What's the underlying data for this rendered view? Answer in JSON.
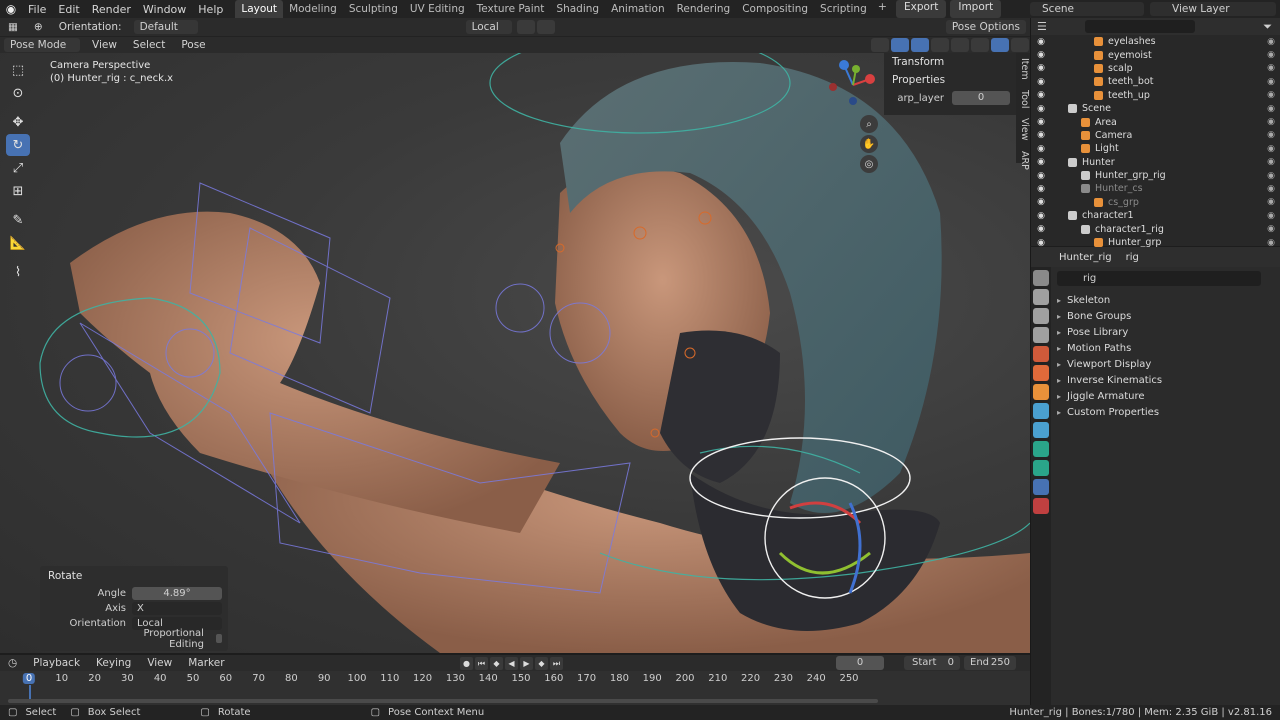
{
  "topbar": {
    "menus": [
      "File",
      "Edit",
      "Render",
      "Window",
      "Help"
    ],
    "workspaces": [
      "Layout",
      "Modeling",
      "Sculpting",
      "UV Editing",
      "Texture Paint",
      "Shading",
      "Animation",
      "Rendering",
      "Compositing",
      "Scripting"
    ],
    "active_workspace": "Layout",
    "export_label": "Export",
    "import_label": "Import",
    "scene": "Scene",
    "view_layer": "View Layer"
  },
  "viewport_header": {
    "orientation_label": "Orientation:",
    "orientation_value": "Default",
    "transform_space": "Local",
    "pose_options": "Pose Options",
    "mode": "Pose Mode",
    "menus": [
      "View",
      "Select",
      "Pose"
    ]
  },
  "viewport": {
    "camera_label": "Camera Perspective",
    "object_label": "(0) Hunter_rig : c_neck.x"
  },
  "npanel": {
    "transform": "Transform",
    "properties": "Properties",
    "field_label": "arp_layer",
    "field_value": "0",
    "tabs": [
      "Item",
      "Tool",
      "View",
      "ARP"
    ]
  },
  "operator": {
    "title": "Rotate",
    "angle_label": "Angle",
    "angle_value": "4.89°",
    "axis_label": "Axis",
    "axis_value": "X",
    "orientation_label": "Orientation",
    "orientation_value": "Local",
    "proportional_label": "Proportional Editing"
  },
  "timeline": {
    "menus": [
      "Playback",
      "Keying",
      "View",
      "Marker"
    ],
    "current_frame": "0",
    "start_label": "Start",
    "start_value": "0",
    "end_label": "End",
    "end_value": "250",
    "ticks": [
      "0",
      "10",
      "20",
      "30",
      "40",
      "50",
      "60",
      "70",
      "80",
      "90",
      "100",
      "110",
      "120",
      "130",
      "140",
      "150",
      "160",
      "170",
      "180",
      "190",
      "200",
      "210",
      "220",
      "230",
      "240",
      "250"
    ]
  },
  "statusbar": {
    "select": "Select",
    "box_select": "Box Select",
    "rotate": "Rotate",
    "context_menu": "Pose Context Menu",
    "stats": "Hunter_rig | Bones:1/780 | Mem: 2.35 GiB | v2.81.16"
  },
  "outliner": {
    "rows": [
      {
        "name": "eyelashes",
        "indent": 3,
        "icon": "#e8913a",
        "dim": false
      },
      {
        "name": "eyemoist",
        "indent": 3,
        "icon": "#e8913a",
        "dim": false
      },
      {
        "name": "scalp",
        "indent": 3,
        "icon": "#e8913a",
        "dim": false
      },
      {
        "name": "teeth_bot",
        "indent": 3,
        "icon": "#e8913a",
        "dim": false
      },
      {
        "name": "teeth_up",
        "indent": 3,
        "icon": "#e8913a",
        "dim": false
      },
      {
        "name": "Scene",
        "indent": 1,
        "icon": "#cccccc",
        "dim": false
      },
      {
        "name": "Area",
        "indent": 2,
        "icon": "#e8913a",
        "dim": false
      },
      {
        "name": "Camera",
        "indent": 2,
        "icon": "#e8913a",
        "dim": false
      },
      {
        "name": "Light",
        "indent": 2,
        "icon": "#e8913a",
        "dim": false
      },
      {
        "name": "Hunter",
        "indent": 1,
        "icon": "#cccccc",
        "dim": false
      },
      {
        "name": "Hunter_grp_rig",
        "indent": 2,
        "icon": "#cccccc",
        "dim": false
      },
      {
        "name": "Hunter_cs",
        "indent": 2,
        "icon": "#8a8a8a",
        "dim": true
      },
      {
        "name": "cs_grp",
        "indent": 3,
        "icon": "#e8913a",
        "dim": true
      },
      {
        "name": "character1",
        "indent": 1,
        "icon": "#cccccc",
        "dim": false
      },
      {
        "name": "character1_rig",
        "indent": 2,
        "icon": "#cccccc",
        "dim": false
      },
      {
        "name": "Hunter_grp",
        "indent": 3,
        "icon": "#e8913a",
        "dim": false
      }
    ]
  },
  "properties": {
    "object": "Hunter_rig",
    "data": "rig",
    "search": "rig",
    "panels": [
      "Skeleton",
      "Bone Groups",
      "Pose Library",
      "Motion Paths",
      "Viewport Display",
      "Inverse Kinematics",
      "Jiggle Armature",
      "Custom Properties"
    ],
    "tab_colors": [
      "#8a8a8a",
      "#a0a0a0",
      "#a0a0a0",
      "#a0a0a0",
      "#d05a3a",
      "#e06a3a",
      "#e8913a",
      "#4aa0d0",
      "#4aa0d0",
      "#2aa58a",
      "#2aa58a",
      "#4772b3",
      "#c04040"
    ]
  }
}
